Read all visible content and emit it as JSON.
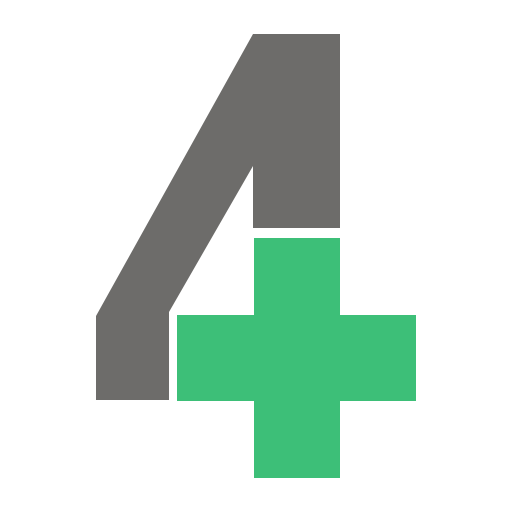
{
  "logo": {
    "icon": "four-plus-logo-icon",
    "colors": {
      "background": "#ffffff",
      "four": "#6d6c6a",
      "plus": "#3dbf78"
    }
  }
}
